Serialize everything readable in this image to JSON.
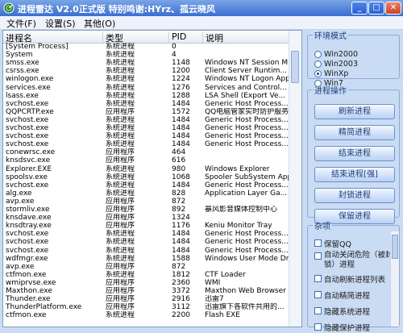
{
  "window": {
    "title": "进程雷达 V2.0正式版 特别鸣谢:HYrz、孤云晓风",
    "buttons": {
      "minimize": "_",
      "maximize": "□",
      "close": "✕"
    }
  },
  "menu": [
    "文件(F)",
    "设置(S)",
    "其他(O)"
  ],
  "table": {
    "columns": [
      "进程名",
      "类型",
      "PID",
      "说明"
    ],
    "rows": [
      [
        "[System Process]",
        "系统进程",
        "0",
        ""
      ],
      [
        "System",
        "系统进程",
        "4",
        ""
      ],
      [
        "smss.exe",
        "系统进程",
        "1148",
        "Windows NT Session M..."
      ],
      [
        "csrss.exe",
        "系统进程",
        "1200",
        "Client Server Runtim..."
      ],
      [
        "winlogon.exe",
        "系统进程",
        "1224",
        "Windows NT Logon App..."
      ],
      [
        "services.exe",
        "系统进程",
        "1276",
        "Services and Control..."
      ],
      [
        "lsass.exe",
        "系统进程",
        "1288",
        "LSA Shell (Export Ve..."
      ],
      [
        "svchost.exe",
        "系统进程",
        "1484",
        "Generic Host Process..."
      ],
      [
        "QQPCRTP.exe",
        "应用程序",
        "1572",
        "QQ电脑管家实时防护服务"
      ],
      [
        "svchost.exe",
        "系统进程",
        "1484",
        "Generic Host Process..."
      ],
      [
        "svchost.exe",
        "系统进程",
        "1484",
        "Generic Host Process..."
      ],
      [
        "svchost.exe",
        "系统进程",
        "1484",
        "Generic Host Process..."
      ],
      [
        "svchost.exe",
        "系统进程",
        "1484",
        "Generic Host Process..."
      ],
      [
        "conewrsc.exe",
        "应用程序",
        "464",
        ""
      ],
      [
        "knsdsvc.exe",
        "应用程序",
        "616",
        ""
      ],
      [
        "Explorer.EXE",
        "系统进程",
        "980",
        "Windows Explorer"
      ],
      [
        "spoolsv.exe",
        "系统进程",
        "1068",
        "Spooler SubSystem App"
      ],
      [
        "svchost.exe",
        "系统进程",
        "1484",
        "Generic Host Process..."
      ],
      [
        "alg.exe",
        "系统进程",
        "828",
        "Application Layer Ga..."
      ],
      [
        "avp.exe",
        "应用程序",
        "872",
        ""
      ],
      [
        "stormliv.exe",
        "应用程序",
        "892",
        "暴风影音媒体控制中心"
      ],
      [
        "knsdave.exe",
        "应用程序",
        "1324",
        ""
      ],
      [
        "knsdtray.exe",
        "应用程序",
        "1176",
        "Keniu Monitor Tray"
      ],
      [
        "svchost.exe",
        "系统进程",
        "1484",
        "Generic Host Process..."
      ],
      [
        "svchost.exe",
        "系统进程",
        "1484",
        "Generic Host Process..."
      ],
      [
        "svchost.exe",
        "系统进程",
        "1484",
        "Generic Host Process..."
      ],
      [
        "wdfmgr.exe",
        "系统进程",
        "1588",
        "Windows User Mode Dr..."
      ],
      [
        "avp.exe",
        "应用程序",
        "872",
        ""
      ],
      [
        "ctfmon.exe",
        "系统进程",
        "1812",
        "CTF Loader"
      ],
      [
        "wmiprvse.exe",
        "应用程序",
        "2360",
        "WMI"
      ],
      [
        "Maxthon.exe",
        "应用程序",
        "3372",
        "Maxthon Web Browser"
      ],
      [
        "Thunder.exe",
        "应用程序",
        "2916",
        "迅雷7"
      ],
      [
        "ThunderPlatform.exe",
        "应用程序",
        "3112",
        "迅雷旗下各软件共用的..."
      ],
      [
        "ctfmon.exe",
        "系统进程",
        "2200",
        "Flash EXE"
      ]
    ]
  },
  "env": {
    "legend": "环境模式",
    "options": [
      "Win2000",
      "Win2003",
      "WinXp",
      "Win7"
    ],
    "selected": 2
  },
  "ops": {
    "legend": "进程操作",
    "buttons": [
      "刷新进程",
      "精简进程",
      "结束进程",
      "结束进程[强]",
      "封锁进程",
      "保留进程"
    ]
  },
  "misc": {
    "legend": "杂项",
    "items": [
      "保留QQ",
      "自动关闭危险（被封锁）进程",
      "自动刷新进程列表",
      "自动精简进程",
      "隐藏系统进程",
      "隐藏保护进程"
    ]
  }
}
